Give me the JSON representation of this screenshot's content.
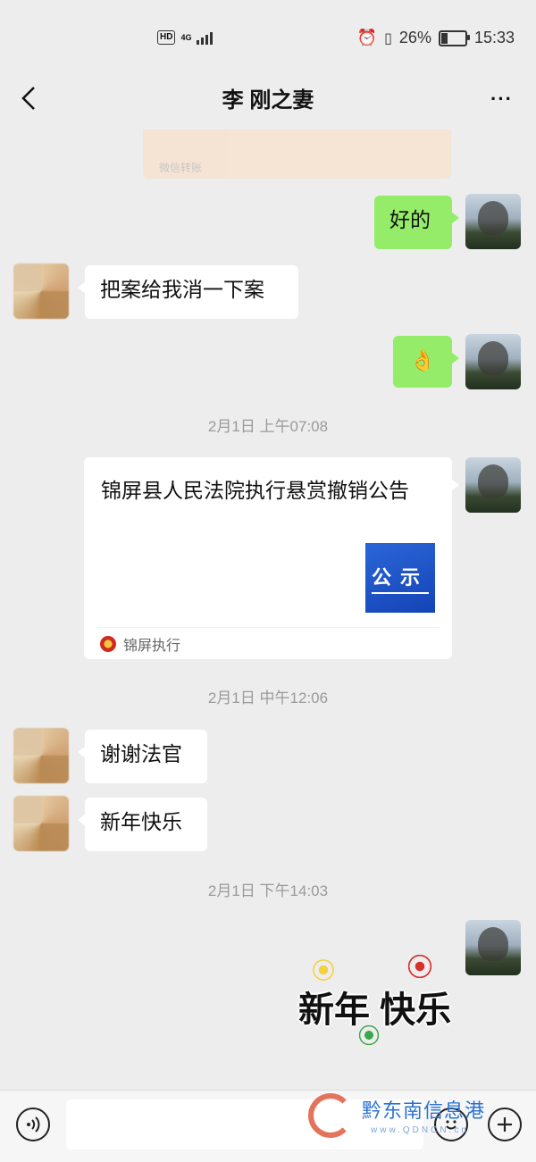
{
  "status_bar": {
    "hd": "HD",
    "net": "4G",
    "battery": "26%",
    "time": "15:33"
  },
  "header": {
    "title": "李   刚之妻",
    "more": "···"
  },
  "partial_card_source": "微信转账",
  "messages": {
    "m1": "好的",
    "m2": "把案给我消一下案",
    "m3_emoji": "👌",
    "t1": "2月1日 上午07:08",
    "card": {
      "title": "锦屏县人民法院执行悬赏撤销公告",
      "thumb_text": "公示",
      "source": "锦屏执行"
    },
    "t2": "2月1日 中午12:06",
    "m4": "谢谢法官",
    "m5": "新年快乐",
    "t3": "2月1日 下午14:03",
    "sticker_text": "新年 快乐"
  },
  "input_bar": {
    "voice_icon": "voice-icon",
    "emoji_icon": "emoji-icon",
    "plus_icon": "plus-icon"
  },
  "watermark": {
    "text": "黔东南信息港",
    "url": "www.QDNCN.cn"
  }
}
